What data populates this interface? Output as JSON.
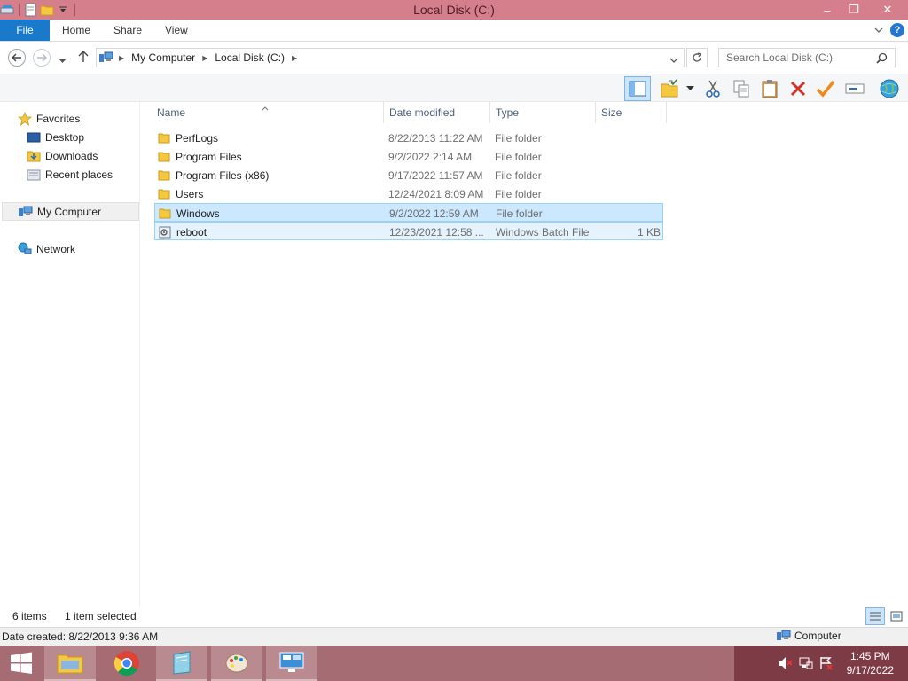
{
  "window": {
    "title": "Local Disk (C:)",
    "controls": {
      "minimize": "–",
      "maximize": "❐",
      "close": "✕"
    },
    "colors": {
      "titlebar": "#d67f8c",
      "accent": "#1979ca",
      "selection": "#cce8ff",
      "taskbar": "#a56c73"
    }
  },
  "ribbon": {
    "file_tab": "File",
    "tabs": [
      "Home",
      "Share",
      "View"
    ],
    "expand_icon": "chevron-down-icon",
    "help_label": "?"
  },
  "address": {
    "segments": [
      "My Computer",
      "Local Disk (C:)"
    ],
    "search_placeholder": "Search Local Disk (C:)"
  },
  "sidebar": {
    "favorites": {
      "label": "Favorites",
      "items": [
        "Desktop",
        "Downloads",
        "Recent places"
      ]
    },
    "computer": "My Computer",
    "network": "Network"
  },
  "file_list": {
    "columns": {
      "name": "Name",
      "date": "Date modified",
      "type": "Type",
      "size": "Size"
    },
    "rows": [
      {
        "name": "PerfLogs",
        "date": "8/22/2013 11:22 AM",
        "type": "File folder",
        "size": "",
        "icon": "folder-icon"
      },
      {
        "name": "Program Files",
        "date": "9/2/2022 2:14 AM",
        "type": "File folder",
        "size": "",
        "icon": "folder-icon"
      },
      {
        "name": "Program Files (x86)",
        "date": "9/17/2022 11:57 AM",
        "type": "File folder",
        "size": "",
        "icon": "folder-icon"
      },
      {
        "name": "Users",
        "date": "12/24/2021 8:09 AM",
        "type": "File folder",
        "size": "",
        "icon": "folder-icon"
      },
      {
        "name": "Windows",
        "date": "9/2/2022 12:59 AM",
        "type": "File folder",
        "size": "",
        "icon": "folder-icon"
      },
      {
        "name": "reboot",
        "date": "12/23/2021 12:58 ...",
        "type": "Windows Batch File",
        "size": "1 KB",
        "icon": "batch-file-icon"
      }
    ]
  },
  "status": {
    "item_count": "6 items",
    "selection": "1 item selected",
    "details": "Date created: 8/22/2013 9:36 AM",
    "location": "Computer"
  },
  "taskbar": {
    "time": "1:45 PM",
    "date": "9/17/2022"
  }
}
